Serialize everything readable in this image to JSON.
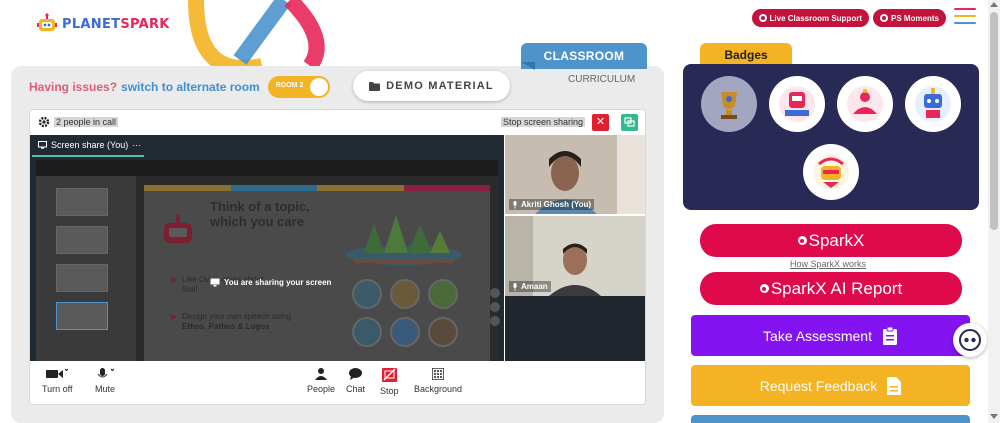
{
  "brand": {
    "name_part1": "PLANET",
    "name_part2": "SPARK"
  },
  "header": {
    "live_support": "Live Classroom Support",
    "ps_moments": "PS Moments"
  },
  "tabs": {
    "classroom": "CLASSROOM",
    "curriculum": "CURRICULUM"
  },
  "issues": {
    "prefix": "Having issues?",
    "link": "switch to alternate room",
    "room_toggle": "ROOM 2"
  },
  "demo_material": "DEMO MATERIAL",
  "meeting": {
    "people_count": "2 people in call",
    "stop_sharing": "Stop screen sharing",
    "share_tab": "Screen share (You)",
    "sharing_note": "You are sharing your screen",
    "slide": {
      "title_line1": "Think of a topic,",
      "title_line2": "which you care",
      "bullet1_line1": "Like Oviya cares about",
      "bullet1_line2": "Soil!",
      "bullet2_line1": "Design your own speech using",
      "bullet2_line2": "Ethos, Pathos & Logos"
    },
    "participants": [
      "Akriti Ghosh (You)",
      "Amaan"
    ],
    "controls": {
      "turn_off": "Turn off",
      "mute": "Mute",
      "people": "People",
      "chat": "Chat",
      "stop": "Stop",
      "background": "Background"
    }
  },
  "badges": {
    "title": "Badges"
  },
  "sidebar": {
    "sparkx": "SparkX",
    "how_sparkx": "How SparkX works",
    "sparkx_report": "SparkX AI Report",
    "take_assessment": "Take Assessment",
    "request_feedback": "Request Feedback"
  },
  "colors": {
    "brand_red": "#df0a4c",
    "brand_blue": "#4d93cc",
    "badge_panel": "#282a55",
    "assessment_purple": "#8313f0",
    "feedback_yellow": "#f4b322"
  }
}
